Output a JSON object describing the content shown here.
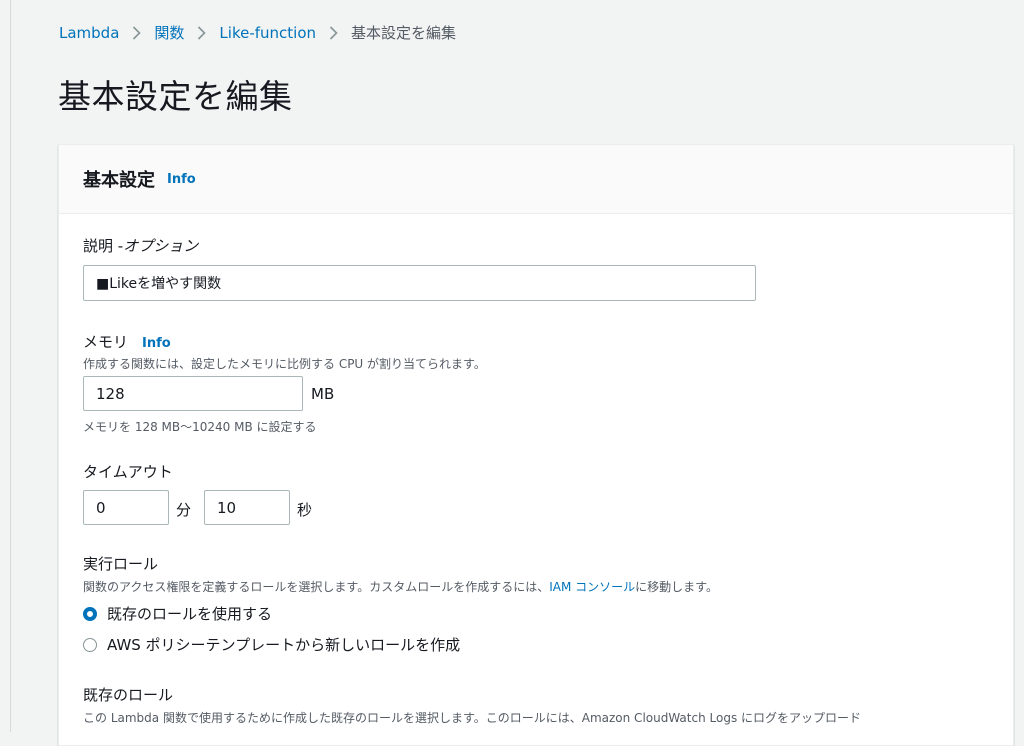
{
  "breadcrumb": {
    "items": [
      "Lambda",
      "関数",
      "Like-function"
    ],
    "current": "基本設定を編集"
  },
  "page": {
    "title": "基本設定を編集"
  },
  "panel": {
    "title": "基本設定",
    "info": "Info",
    "description": {
      "label": "説明 - ",
      "label_optional": "オプション",
      "value": "■Likeを増やす関数"
    },
    "memory": {
      "label": "メモリ",
      "info": "Info",
      "hint": "作成する関数には、設定したメモリに比例する CPU が割り当てられます。",
      "value": "128",
      "unit": "MB",
      "constraint": "メモリを 128 MB〜10240 MB に設定する"
    },
    "timeout": {
      "label": "タイムアウト",
      "minutes": "0",
      "minutes_unit": "分",
      "seconds": "10",
      "seconds_unit": "秒"
    },
    "role": {
      "label": "実行ロール",
      "hint_before": "関数のアクセス権限を定義するロールを選択します。カスタムロールを作成するには、",
      "hint_link": "IAM コンソール",
      "hint_after": "に移動します。",
      "option_existing": "既存のロールを使用する",
      "option_template": "AWS ポリシーテンプレートから新しいロールを作成",
      "selected": "既存のロールを使用する"
    },
    "existing_role": {
      "label": "既存のロール",
      "hint": "この Lambda 関数で使用するために作成した既存のロールを選択します。このロールには、Amazon CloudWatch Logs にログをアップロード"
    }
  },
  "colors": {
    "link": "#0073bb",
    "background": "#f2f3f3",
    "text": "#16191f",
    "hint": "#545b64"
  }
}
